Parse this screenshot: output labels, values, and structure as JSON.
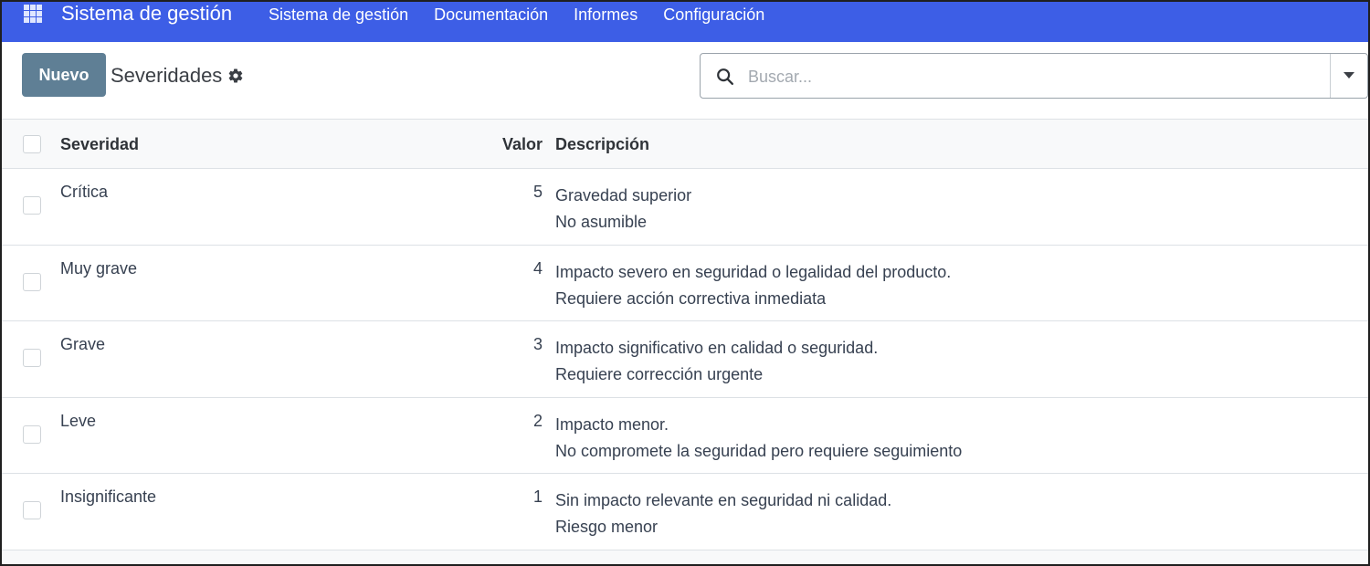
{
  "navbar": {
    "brand": "Sistema de gestión",
    "menu": [
      "Sistema de gestión",
      "Documentación",
      "Informes",
      "Configuración"
    ],
    "color": "#3d5ee6"
  },
  "control_panel": {
    "new_button": "Nuevo",
    "title": "Severidades",
    "search_placeholder": "Buscar..."
  },
  "table": {
    "headers": {
      "name": "Severidad",
      "value": "Valor",
      "description": "Descripción"
    },
    "rows": [
      {
        "name": "Crítica",
        "value": "5",
        "desc1": "Gravedad superior",
        "desc2": "No asumible"
      },
      {
        "name": "Muy grave",
        "value": "4",
        "desc1": "Impacto severo en seguridad o legalidad del producto.",
        "desc2": "Requiere acción correctiva inmediata"
      },
      {
        "name": "Grave",
        "value": "3",
        "desc1": "Impacto significativo en calidad o seguridad.",
        "desc2": "Requiere corrección urgente"
      },
      {
        "name": "Leve",
        "value": "2",
        "desc1": "Impacto menor.",
        "desc2": "No compromete la seguridad pero requiere seguimiento"
      },
      {
        "name": "Insignificante",
        "value": "1",
        "desc1": "Sin impacto relevante en seguridad ni calidad.",
        "desc2": "Riesgo menor"
      }
    ]
  },
  "icons": {
    "apps": "apps-grid-icon",
    "gear": "gear-icon",
    "search": "search-icon",
    "dropdown": "caret-down-icon"
  }
}
